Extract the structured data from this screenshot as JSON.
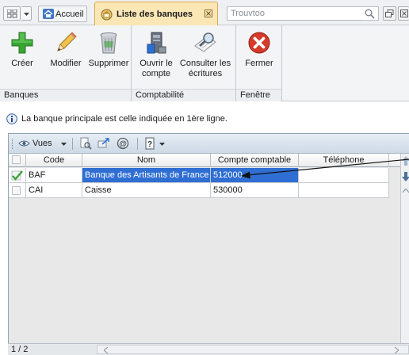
{
  "tabbar": {
    "home_label": "Accueil",
    "active_tab_label": "Liste des banques",
    "search_placeholder": "Trouvtoo"
  },
  "ribbon": {
    "groups": [
      {
        "label": "Banques",
        "buttons": [
          "Créer",
          "Modifier",
          "Supprimer"
        ]
      },
      {
        "label": "Comptabilité",
        "buttons": [
          "Ouvrir le compte",
          "Consulter les écritures"
        ]
      },
      {
        "label": "Fenêtre",
        "buttons": [
          "Fermer"
        ]
      }
    ],
    "labels": {
      "creer": "Créer",
      "modifier": "Modifier",
      "supprimer": "Supprimer",
      "ouvrir_1": "Ouvrir le",
      "ouvrir_2": "compte",
      "consulter_1": "Consulter les",
      "consulter_2": "écritures",
      "fermer": "Fermer",
      "group_banques": "Banques",
      "group_compta": "Comptabilité",
      "group_fenetre": "Fenêtre"
    }
  },
  "info": {
    "text": "La banque principale est celle indiquée en 1ère ligne."
  },
  "table": {
    "toolbar": {
      "vues_label": "Vues"
    },
    "columns": [
      "Code",
      "Nom",
      "Compte comptable",
      "Téléphone"
    ],
    "rows": [
      {
        "code": "BAF",
        "nom": "Banque des Artisants de France",
        "compte": "512000",
        "telephone": "",
        "checked": true
      },
      {
        "code": "CAI",
        "nom": "Caisse",
        "compte": "530000",
        "telephone": "",
        "checked": false
      }
    ]
  },
  "status": {
    "page": "1 / 2"
  },
  "colors": {
    "selection": "#2f6ed3",
    "active_tab": "#fbe7b6",
    "create_icon": "#3aa335",
    "close_icon": "#d63a2a"
  }
}
